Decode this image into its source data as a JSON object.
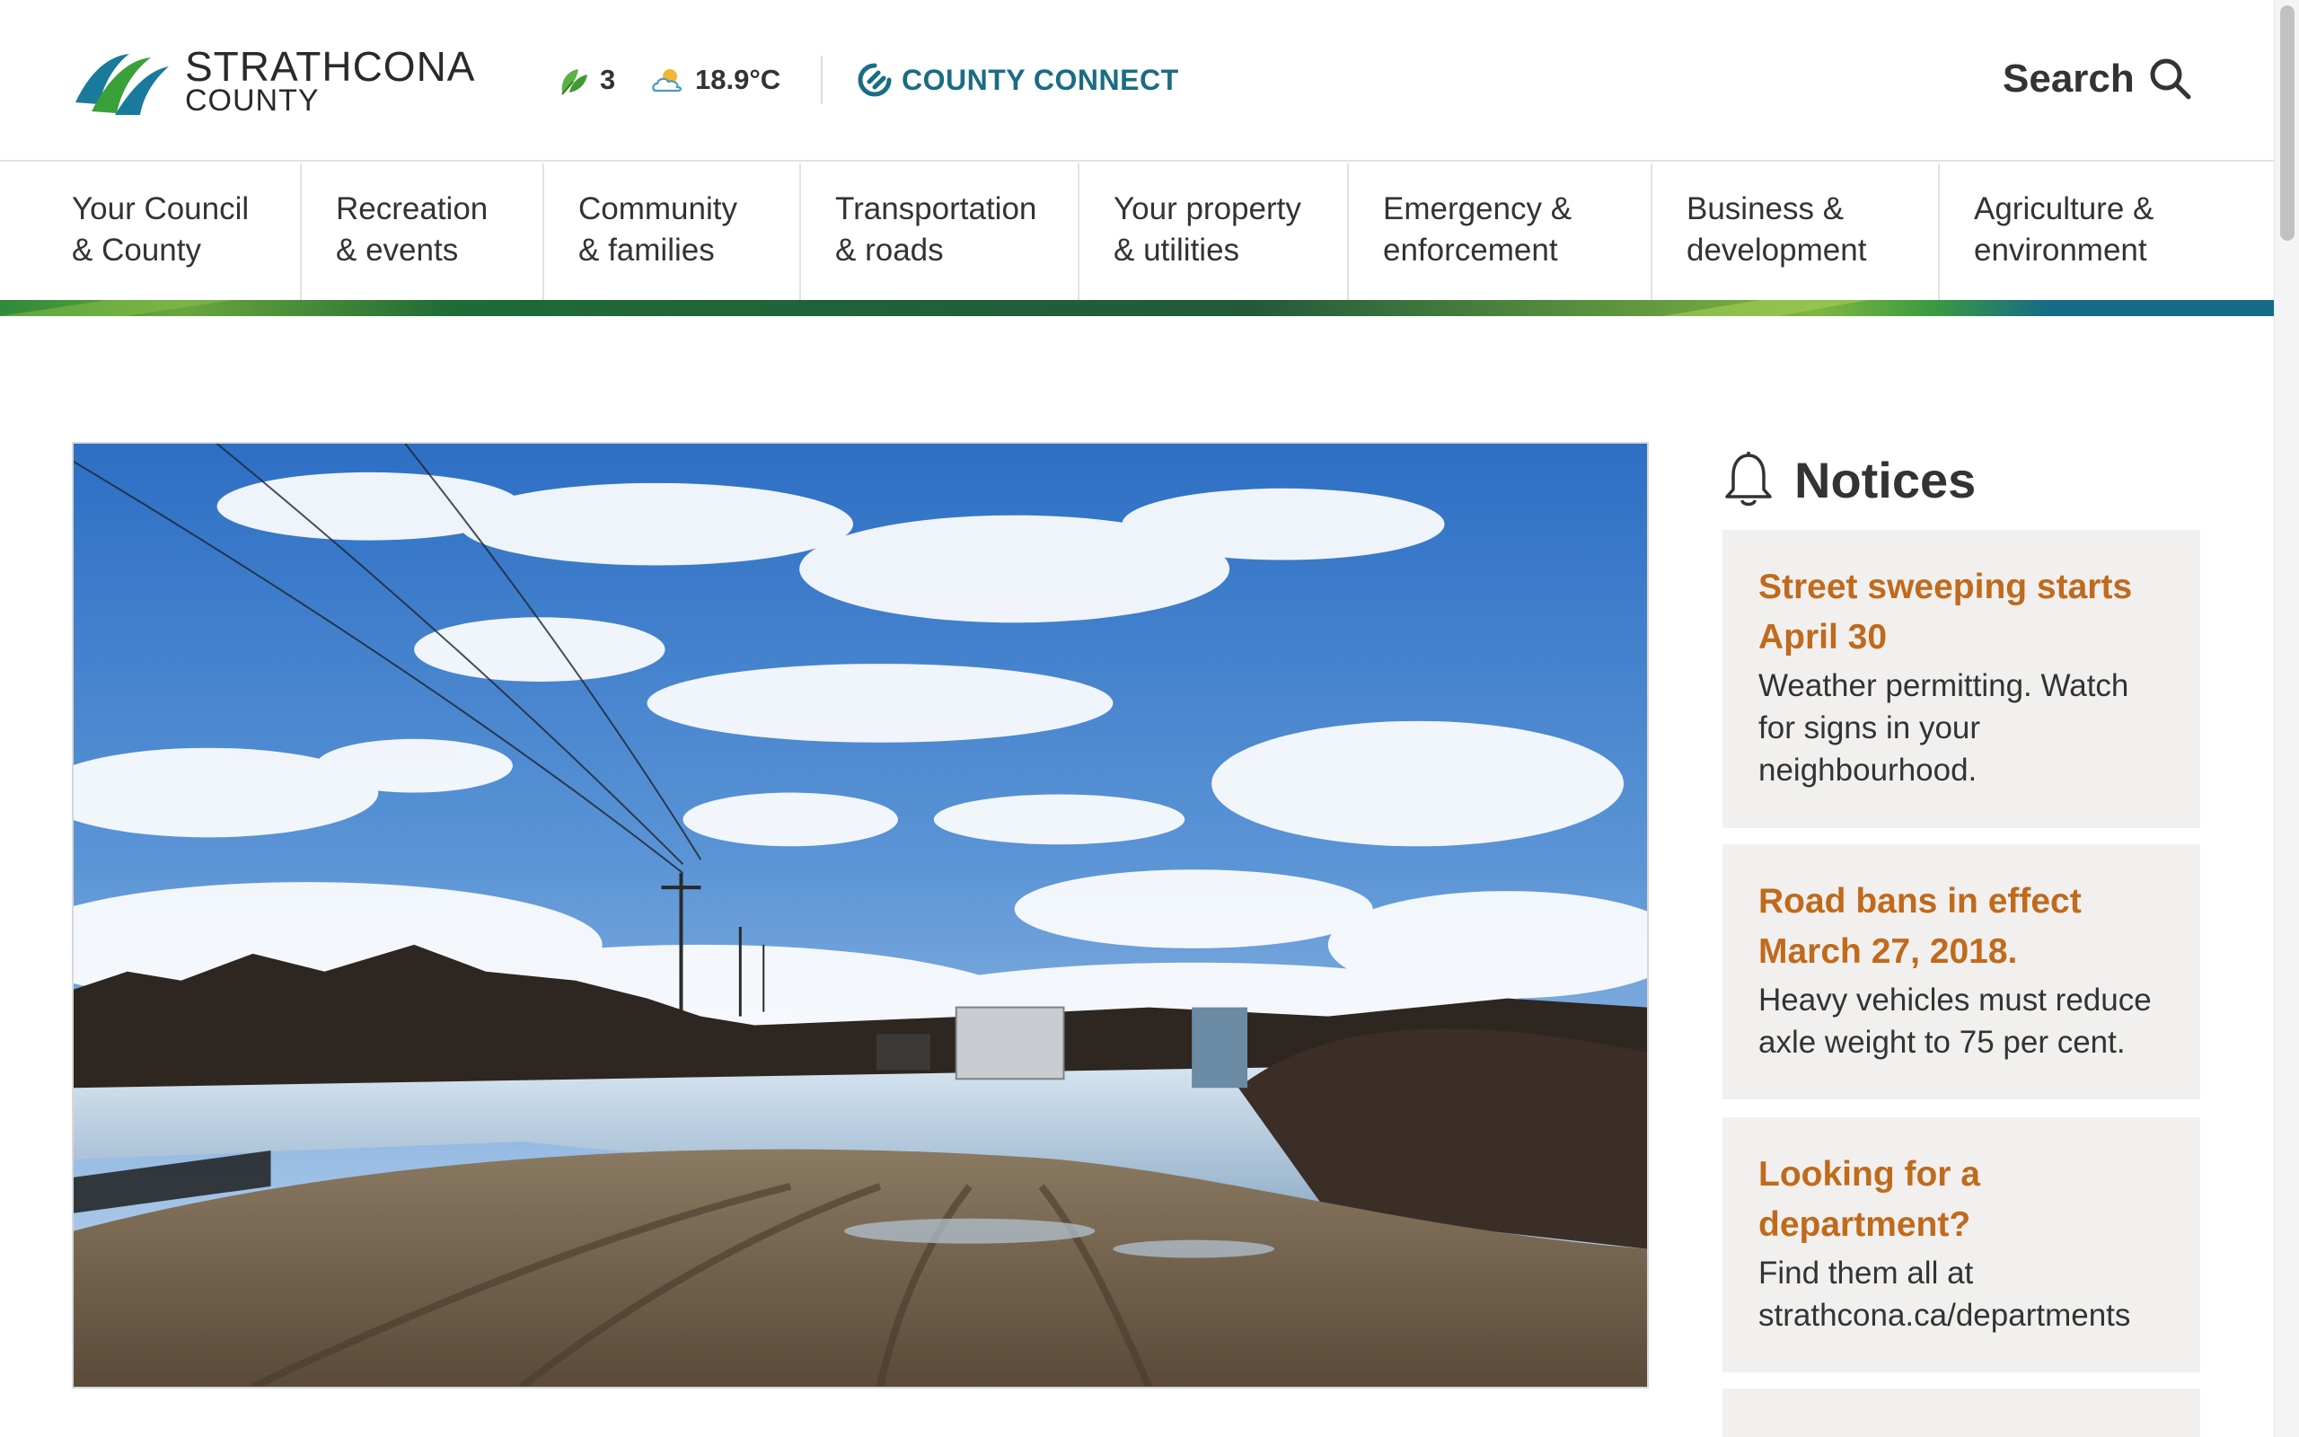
{
  "header": {
    "logo": {
      "name": "STRATHCONA",
      "sub": "COUNTY"
    },
    "leaf_status": {
      "value": "3",
      "icon": "leaf-icon"
    },
    "weather": {
      "value": "18.9°C",
      "icon": "partly-cloudy-icon"
    },
    "county_connect": {
      "label": "COUNTY CONNECT",
      "icon": "connect-icon"
    },
    "search": {
      "label": "Search",
      "icon": "search-icon"
    }
  },
  "nav": {
    "items": [
      {
        "line1": "Your Council",
        "line2": "& County"
      },
      {
        "line1": "Recreation",
        "line2": "& events"
      },
      {
        "line1": "Community",
        "line2": "& families"
      },
      {
        "line1": "Transportation",
        "line2": "& roads"
      },
      {
        "line1": "Your property",
        "line2": "& utilities"
      },
      {
        "line1": "Emergency &",
        "line2": "enforcement"
      },
      {
        "line1": "Business &",
        "line2": "development"
      },
      {
        "line1": "Agriculture &",
        "line2": "environment"
      }
    ]
  },
  "notices": {
    "title": "Notices",
    "icon": "bell-icon",
    "items": [
      {
        "title_line1": "Street sweeping starts",
        "title_line2": "April 30",
        "text_line1": "Weather permitting. Watch",
        "text_line2": "for signs in your",
        "text_line3": "neighbourhood."
      },
      {
        "title_line1": "Road bans in effect",
        "title_line2": "March 27, 2018.",
        "text_line1": "Heavy vehicles must reduce",
        "text_line2": "axle weight to 75 per cent."
      },
      {
        "title_line1": "Looking for a",
        "title_line2": "department?",
        "text_line1": "Find them all at",
        "text_line2": "strathcona.ca/departments"
      }
    ]
  },
  "colors": {
    "accent_orange": "#c06a1c",
    "connect_teal": "#1a6c84",
    "stripe_green": "#2f8a3a",
    "stripe_blue": "#176b86",
    "card_bg": "#f1f0ef"
  }
}
